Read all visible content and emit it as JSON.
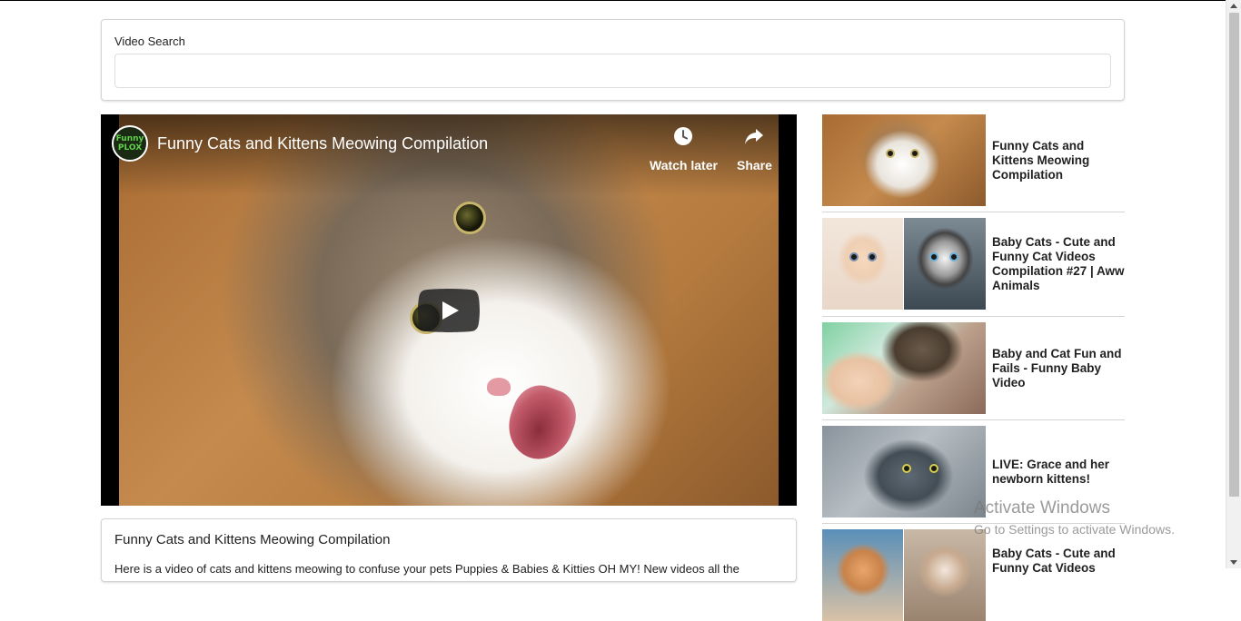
{
  "search": {
    "label": "Video Search",
    "value": "",
    "placeholder": ""
  },
  "player": {
    "channel_logo_text": [
      "Funny",
      "PLOX"
    ],
    "title": "Funny Cats and Kittens Meowing Compilation",
    "watch_later_label": "Watch later",
    "share_label": "Share",
    "icons": {
      "watch_later": "clock-icon",
      "share": "share-arrow-icon",
      "play": "play-icon"
    },
    "play_button_color": "#212121"
  },
  "detail": {
    "title": "Funny Cats and Kittens Meowing Compilation",
    "description": "Here is a video of cats and kittens meowing to confuse your pets Puppies & Babies & Kitties OH MY! New videos all the"
  },
  "video_list": [
    {
      "title": "Funny Cats and Kittens Meowing Compilation"
    },
    {
      "title": "Baby Cats - Cute and Funny Cat Videos Compilation #27 | Aww Animals"
    },
    {
      "title": "Baby and Cat Fun and Fails - Funny Baby Video"
    },
    {
      "title": "LIVE: Grace and her newborn kittens!"
    },
    {
      "title": "Baby Cats - Cute and Funny Cat Videos"
    }
  ],
  "watermark": {
    "line1": "Activate Windows",
    "line2": "Go to Settings to activate Windows."
  },
  "colors": {
    "border": "#d4d4d5",
    "text": "#212121",
    "background": "#ffffff"
  }
}
